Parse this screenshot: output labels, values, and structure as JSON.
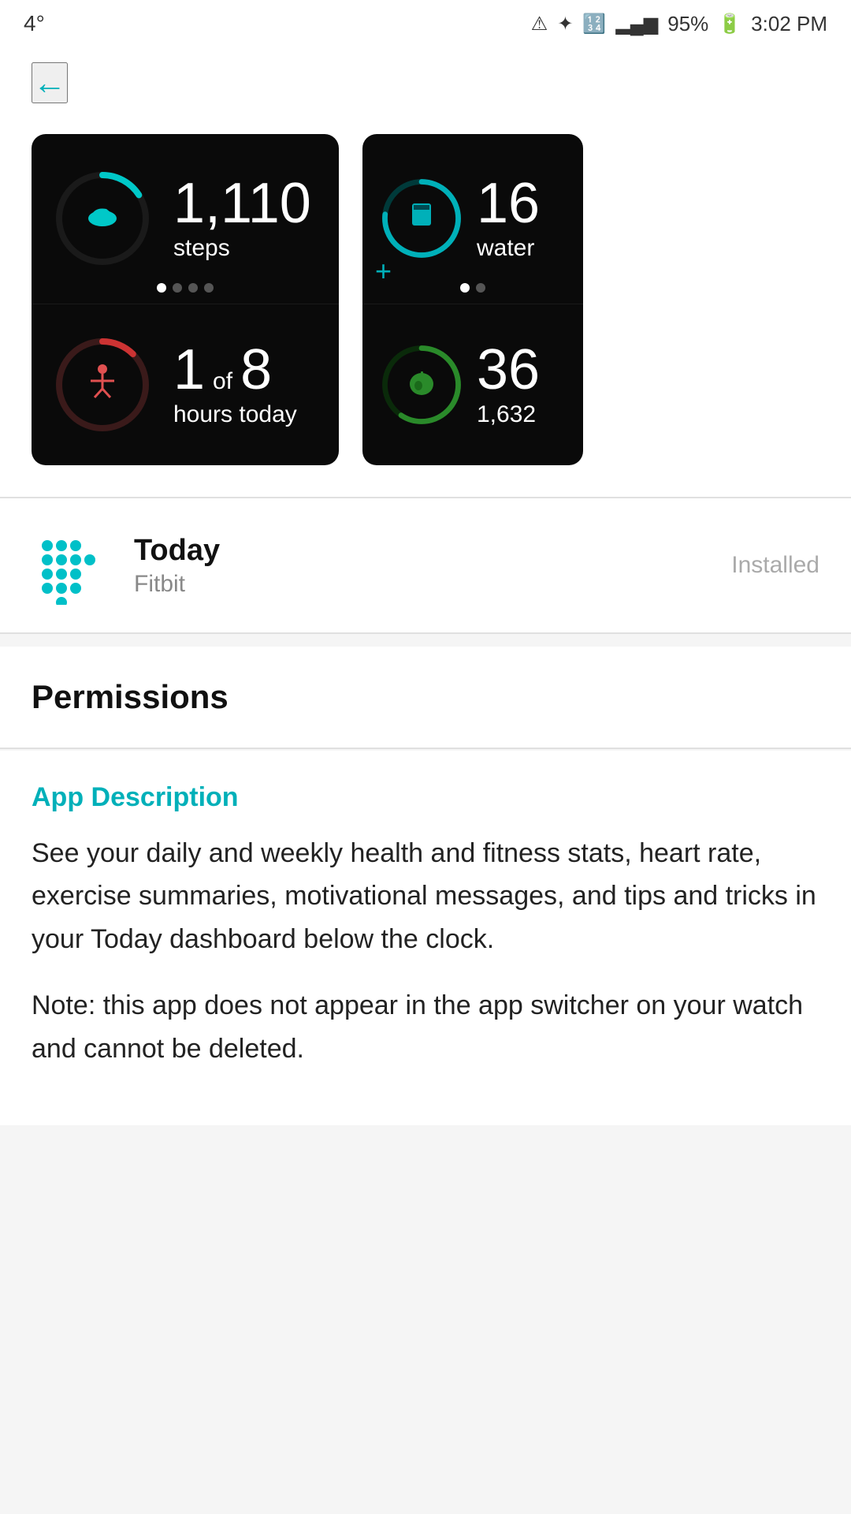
{
  "statusBar": {
    "temperature": "4°",
    "batteryPercent": "95%",
    "time": "3:02 PM"
  },
  "nav": {
    "backLabel": "←"
  },
  "screenshots": {
    "left": {
      "topStat": {
        "number": "1,110",
        "label": "steps"
      },
      "bottomStat": {
        "number": "1",
        "of": "of",
        "total": "8",
        "label": "hours today"
      },
      "dots": [
        true,
        false,
        false,
        false
      ]
    },
    "right": {
      "topStat": {
        "number": "16",
        "label": "water"
      },
      "bottomStat": {
        "number": "36",
        "subLabel": "1,632"
      },
      "dots": [
        false,
        true
      ]
    }
  },
  "appInfo": {
    "name": "Today",
    "developer": "Fitbit",
    "status": "Installed"
  },
  "permissions": {
    "title": "Permissions"
  },
  "description": {
    "heading": "App Description",
    "paragraph1": "See your daily and weekly health and fitness stats, heart rate, exercise summaries, motivational messages, and tips and tricks in your Today dashboard below the clock.",
    "paragraph2": "Note: this app does not appear in the app switcher on your watch and cannot be deleted."
  }
}
